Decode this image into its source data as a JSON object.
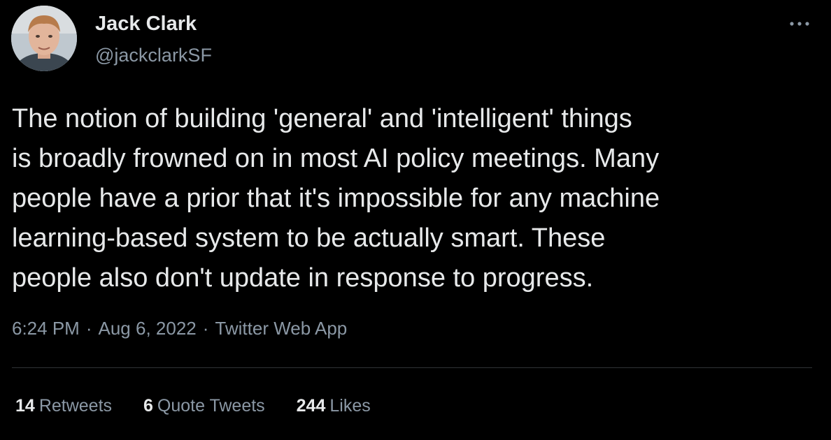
{
  "author": {
    "name": "Jack Clark",
    "handle": "@jackclarkSF"
  },
  "tweet": {
    "lines": [
      "The notion of building 'general' and 'intelligent' things",
      "is broadly frowned on in most AI policy meetings. Many",
      "people have a prior that it's impossible for any machine",
      "learning-based system to be actually smart. These",
      "people also don't update in response to progress."
    ]
  },
  "meta": {
    "time": "6:24 PM",
    "separator": "·",
    "date": "Aug 6, 2022",
    "source": "Twitter Web App"
  },
  "stats": {
    "retweets_count": "14",
    "retweets_label": "Retweets",
    "quotes_count": "6",
    "quotes_label": "Quote Tweets",
    "likes_count": "244",
    "likes_label": "Likes"
  },
  "icons": {
    "more": "more-horizontal-icon",
    "avatar": "avatar-photo"
  },
  "colors": {
    "background": "#000000",
    "primary_text": "#e7e9ea",
    "secondary_text": "#8b98a5",
    "divider": "#2f3336"
  }
}
